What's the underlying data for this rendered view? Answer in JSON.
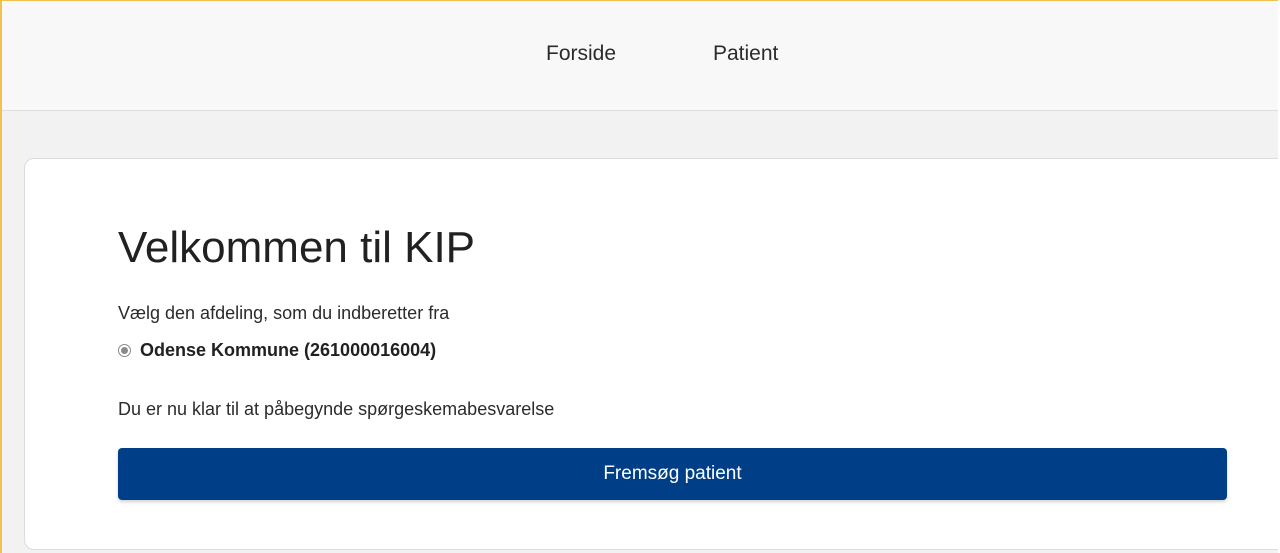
{
  "nav": {
    "items": [
      {
        "label": "Forside"
      },
      {
        "label": "Patient"
      }
    ]
  },
  "card": {
    "title": "Velkommen til KIP",
    "prompt": "Vælg den afdeling, som du indberetter fra",
    "department_option": {
      "label": "Odense Kommune (261000016004)",
      "selected": true
    },
    "ready_text": "Du er nu klar til at påbegynde spørgeskemabesvarelse",
    "search_button_label": "Fremsøg patient"
  },
  "colors": {
    "primary_button": "#003f87",
    "frame_border": "#f2c24f",
    "page_background": "#f2f2f2"
  }
}
